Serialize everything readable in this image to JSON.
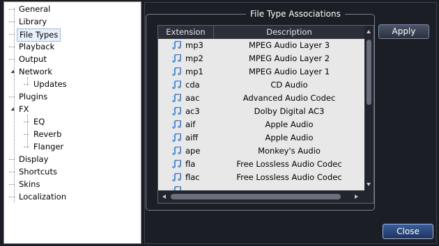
{
  "tree": {
    "items": [
      {
        "label": "General"
      },
      {
        "label": "Library"
      },
      {
        "label": "File Types"
      },
      {
        "label": "Playback"
      },
      {
        "label": "Output"
      },
      {
        "label": "Network"
      },
      {
        "label": "Updates"
      },
      {
        "label": "Plugins"
      },
      {
        "label": "FX"
      },
      {
        "label": "EQ"
      },
      {
        "label": "Reverb"
      },
      {
        "label": "Flanger"
      },
      {
        "label": "Display"
      },
      {
        "label": "Shortcuts"
      },
      {
        "label": "Skins"
      },
      {
        "label": "Localization"
      }
    ],
    "selected": "File Types"
  },
  "group": {
    "title": "File Type Associations"
  },
  "list": {
    "columns": [
      "Extension",
      "Description"
    ],
    "rows": [
      {
        "ext": "mp3",
        "desc": "MPEG Audio Layer 3"
      },
      {
        "ext": "mp2",
        "desc": "MPEG Audio Layer 2"
      },
      {
        "ext": "mp1",
        "desc": "MPEG Audio Layer 1"
      },
      {
        "ext": "cda",
        "desc": "CD Audio"
      },
      {
        "ext": "aac",
        "desc": "Advanced Audio Codec"
      },
      {
        "ext": "ac3",
        "desc": "Dolby Digital AC3"
      },
      {
        "ext": "aif",
        "desc": "Apple Audio"
      },
      {
        "ext": "aiff",
        "desc": "Apple Audio"
      },
      {
        "ext": "ape",
        "desc": "Monkey's Audio"
      },
      {
        "ext": "fla",
        "desc": "Free Lossless Audio Codec"
      },
      {
        "ext": "flac",
        "desc": "Free Lossless Audio Codec"
      },
      {
        "ext": "",
        "desc": ""
      }
    ]
  },
  "buttons": {
    "apply": "Apply",
    "close": "Close"
  },
  "colors": {
    "accent": "#2d4f8a",
    "panel_bg": "#1c1e26",
    "list_bg": "#e8e8e8"
  }
}
